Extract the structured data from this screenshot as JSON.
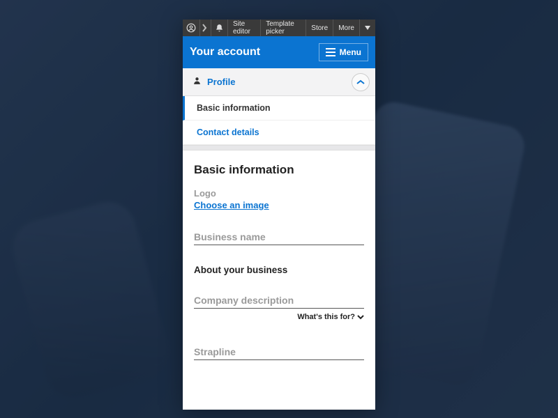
{
  "topbar": {
    "items": [
      "Site editor",
      "Template picker",
      "Store",
      "More"
    ]
  },
  "header": {
    "title": "Your account",
    "menu_label": "Menu"
  },
  "section": {
    "label": "Profile",
    "subnav": {
      "active": "Basic information",
      "link": "Contact details"
    }
  },
  "form": {
    "heading": "Basic information",
    "logo_label": "Logo",
    "choose_image": "Choose an image",
    "business_name_placeholder": "Business name",
    "about_heading": "About your business",
    "company_desc_placeholder": "Company description",
    "whats_this": "What's this for?",
    "strapline_placeholder": "Strapline"
  }
}
